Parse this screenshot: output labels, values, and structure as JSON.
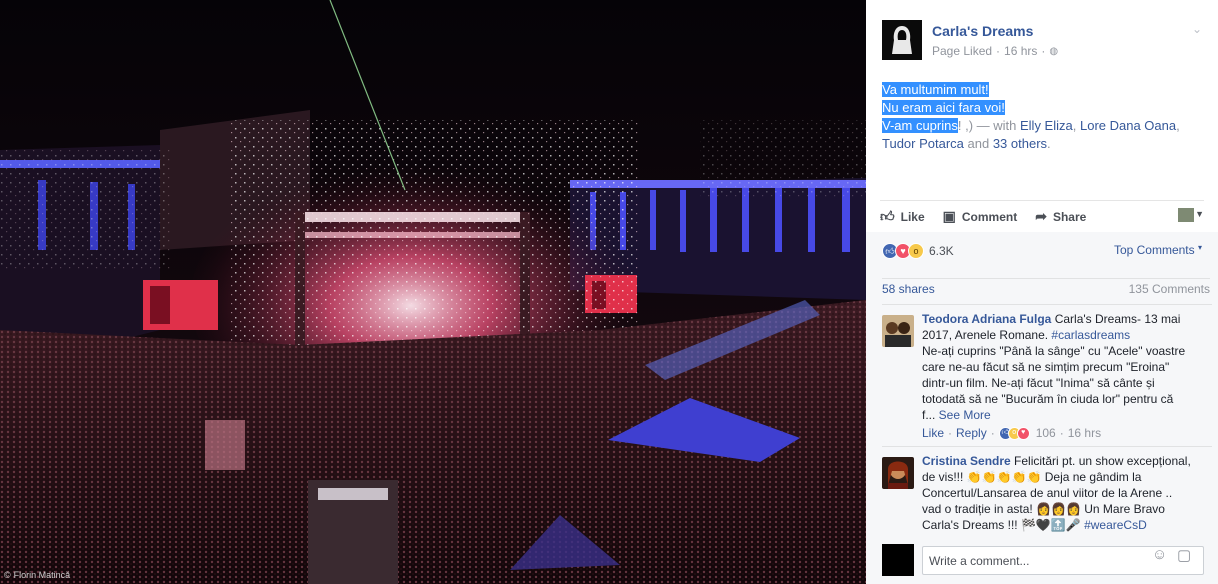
{
  "photo": {
    "credit_icon": "copyright-icon",
    "credit_text": "Florin Matincă"
  },
  "post": {
    "page_name": "Carla's Dreams",
    "meta_status": "Page Liked",
    "meta_sep": "·",
    "meta_time": "16 hrs",
    "meta_icon": "globe-icon",
    "line1": "Va multumim mult!",
    "line2": "Nu eram aici fara voi!",
    "line3_highlight": "V-am cuprins",
    "line3_rest": "! ,) — with ",
    "tag1": "Elly Eliza",
    "sep1": ", ",
    "tag2": "Lore Dana Oana",
    "sep2": ",",
    "tag3": "Tudor Potarca",
    "and_text": " and ",
    "others": "33 others",
    "end": "."
  },
  "actions": {
    "like": "Like",
    "comment": "Comment",
    "share": "Share",
    "like_icon": "thumbs-up-icon",
    "comment_icon": "speech-bubble-icon",
    "share_icon": "share-arrow-icon"
  },
  "reactions": {
    "count": "6.3K",
    "types": [
      "like",
      "love",
      "wow"
    ],
    "top_comments": "Top Comments"
  },
  "stats": {
    "shares": "58 shares",
    "comments": "135 Comments"
  },
  "comments": [
    {
      "author": "Teodora Adriana Fulga",
      "text_lines": [
        "Carla's Dreams- 13 mai",
        "2017, Arenele Romane. "
      ],
      "hashtag": "#carlasdreams",
      "more_lines": [
        "Ne-ați cuprins \"Până la sânge\" cu \"Acele\" voastre",
        "care ne-au făcut să ne simțim precum \"Eroina\"",
        "dintr-un film. Ne-ați făcut \"Inima\" să cânte și",
        "totodată să ne \"Bucurăm în ciuda lor\" pentru că",
        "f... "
      ],
      "see_more": "See More",
      "like": "Like",
      "reply": "Reply",
      "sep": "·",
      "reaction_count": "106",
      "time": "16 hrs"
    },
    {
      "author": "Cristina Sendre",
      "lines": [
        "Felicitări pt. un show excepțional,",
        "de vis!!! 👏👏👏👏👏 Deja ne gândim la",
        "Concertul/Lansarea de anul viitor de la Arene ..",
        "vad o tradiție in asta! 👩👩👩 Un Mare Bravo",
        "Carla's Dreams !!! 🏁🖤🔝🎤 "
      ],
      "hashtag": "#weareCsD"
    }
  ],
  "compose": {
    "placeholder": "Write a comment...",
    "emoji_icon": "smiley-icon",
    "sticker_icon": "sticker-icon"
  },
  "colors": {
    "link_blue": "#365899",
    "highlight": "#3390ff",
    "stage_blue": "#3b3fd6",
    "stage_red": "#e0304a"
  }
}
